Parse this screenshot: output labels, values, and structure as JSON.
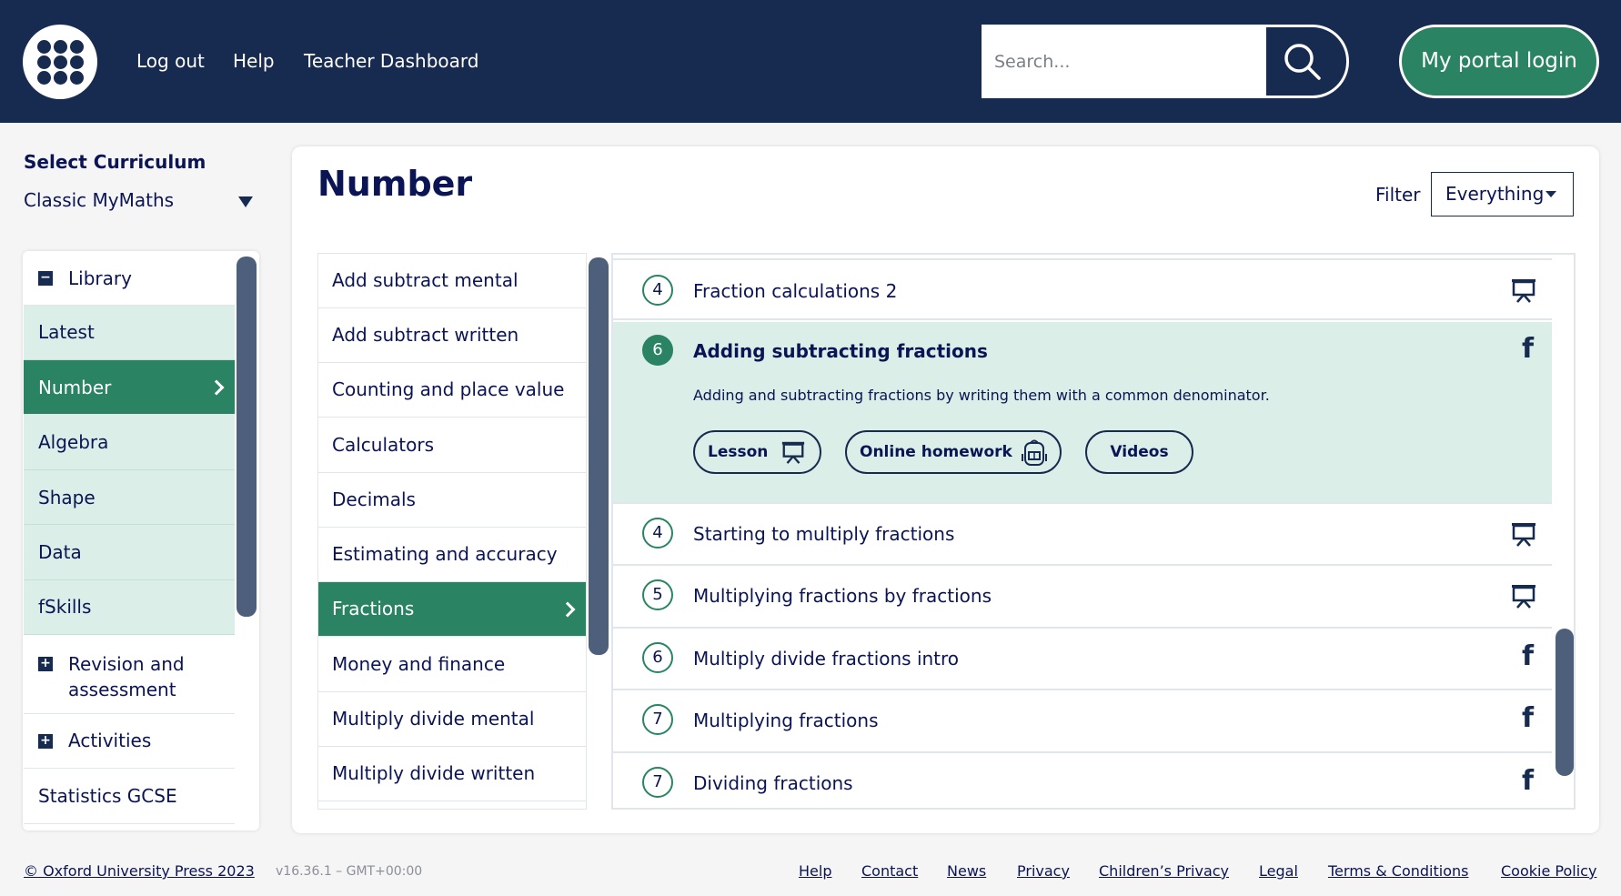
{
  "header": {
    "nav": [
      "Log out",
      "Help",
      "Teacher Dashboard"
    ],
    "search_placeholder": "Search...",
    "portal_button": "My portal login"
  },
  "curriculum": {
    "title": "Select Curriculum",
    "selected": "Classic MyMaths"
  },
  "sidebar": {
    "items": [
      {
        "label": "Library",
        "icon": "minus-box-icon"
      },
      {
        "label": "Latest"
      },
      {
        "label": "Number",
        "active": true
      },
      {
        "label": "Algebra"
      },
      {
        "label": "Shape"
      },
      {
        "label": "Data"
      },
      {
        "label": "fSkills"
      },
      {
        "label": "Revision and",
        "label2": "assessment",
        "icon": "plus-box-icon"
      },
      {
        "label": "Activities",
        "icon": "plus-box-icon"
      },
      {
        "label": "Statistics GCSE"
      }
    ]
  },
  "main": {
    "title": "Number",
    "filter_label": "Filter",
    "filter_value": "Everything"
  },
  "topics": [
    "Add subtract mental",
    "Add subtract written",
    "Counting and place value",
    "Calculators",
    "Decimals",
    "Estimating and accuracy",
    "Fractions",
    "Money and finance",
    "Multiply divide mental",
    "Multiply divide written"
  ],
  "active_topic": "Fractions",
  "lessons": [
    {
      "level": "4",
      "name": "Fraction calculations 2",
      "icon": "presentation-icon"
    },
    {
      "level": "6",
      "name": "Adding subtracting fractions",
      "icon": "f-icon",
      "expanded": true,
      "description": "Adding and subtracting fractions by writing them with a common denominator.",
      "buttons": [
        "Lesson",
        "Online homework",
        "Videos"
      ]
    },
    {
      "level": "4",
      "name": "Starting to multiply fractions",
      "icon": "presentation-icon"
    },
    {
      "level": "5",
      "name": "Multiplying fractions by fractions",
      "icon": "presentation-icon"
    },
    {
      "level": "6",
      "name": "Multiply divide fractions intro",
      "icon": "f-icon"
    },
    {
      "level": "7",
      "name": "Multiplying fractions",
      "icon": "f-icon"
    },
    {
      "level": "7",
      "name": "Dividing fractions",
      "icon": "f-icon"
    }
  ],
  "f_glyph": "f",
  "footer": {
    "copyright": "© Oxford University Press 2023",
    "version": "v16.36.1 – GMT+00:00",
    "links": [
      "Help",
      "Contact",
      "News",
      "Privacy",
      "Children’s Privacy",
      "Legal",
      "Terms & Conditions",
      "Cookie Policy"
    ]
  },
  "colors": {
    "navy": "#172a4f",
    "green": "#2a8463",
    "mint": "#dbefe8",
    "text": "#0b1454"
  }
}
